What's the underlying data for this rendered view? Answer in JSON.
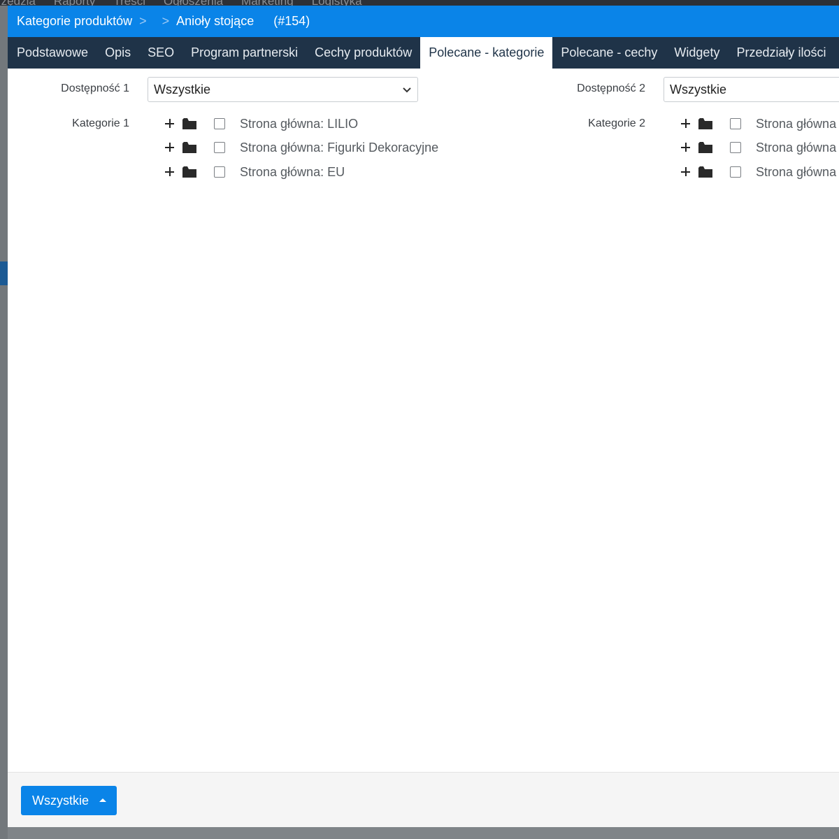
{
  "background_menu": [
    "rzędzia",
    "Raporty",
    "Treści",
    "Ogłoszenia",
    "Marketing",
    "Logistyka"
  ],
  "breadcrumb": {
    "parent": "Kategorie produktów",
    "current": "Anioły stojące",
    "id": "(#154)"
  },
  "tabs": [
    {
      "label": "Podstawowe",
      "active": false
    },
    {
      "label": "Opis",
      "active": false
    },
    {
      "label": "SEO",
      "active": false
    },
    {
      "label": "Program partnerski",
      "active": false
    },
    {
      "label": "Cechy produktów",
      "active": false
    },
    {
      "label": "Polecane - kategorie",
      "active": true
    },
    {
      "label": "Polecane - cechy",
      "active": false
    },
    {
      "label": "Widgety",
      "active": false
    },
    {
      "label": "Przedziały ilości",
      "active": false
    }
  ],
  "column1": {
    "availability_label": "Dostępność 1",
    "availability_value": "Wszystkie",
    "categories_label": "Kategorie 1",
    "items": [
      "Strona główna: LILIO",
      "Strona główna: Figurki Dekoracyjne",
      "Strona główna: EU"
    ]
  },
  "column2": {
    "availability_label": "Dostępność 2",
    "availability_value": "Wszystkie",
    "categories_label": "Kategorie 2",
    "items": [
      "Strona główna",
      "Strona główna",
      "Strona główna"
    ]
  },
  "footer": {
    "button_label": "Wszystkie"
  },
  "colors": {
    "accent": "#0a84e8",
    "tabs_bg": "#1f3348"
  }
}
